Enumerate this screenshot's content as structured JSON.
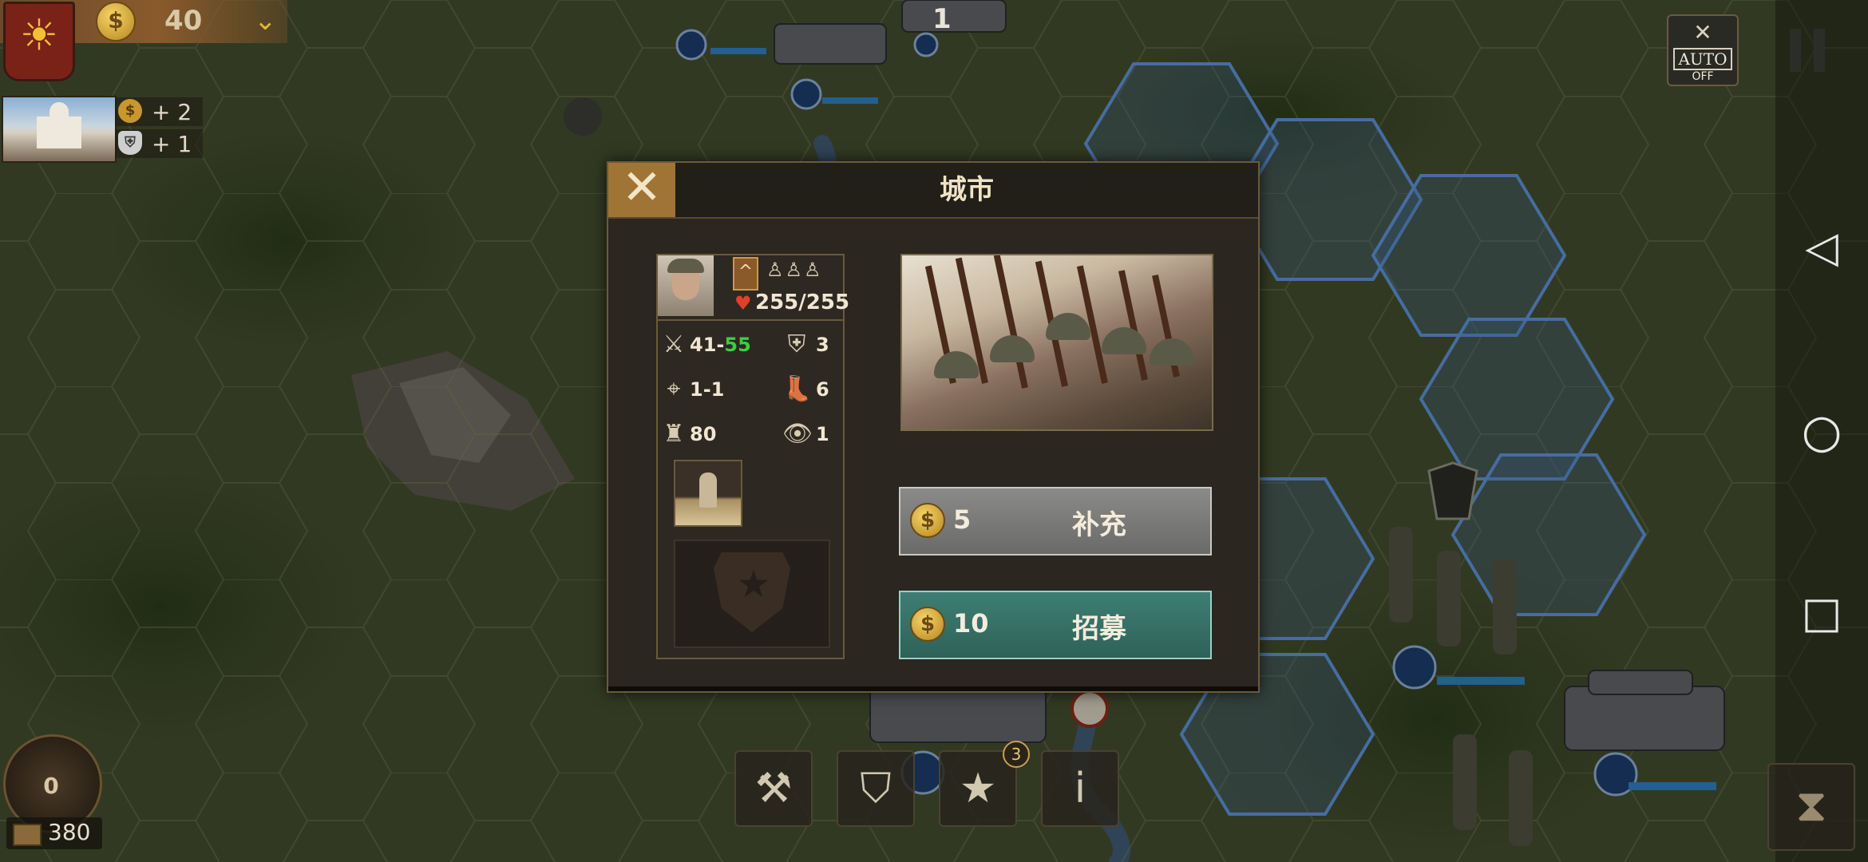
{
  "top_bar": {
    "faction_icon": "sun-emblem-icon",
    "gold": "40",
    "city_bonus_gold": "+ 2",
    "city_bonus_defense": "+ 1"
  },
  "top_right": {
    "auto_label": "AUTO",
    "auto_state": "OFF"
  },
  "bottom_left": {
    "turn_count": "0",
    "supply": "380"
  },
  "dialog": {
    "title": "城市",
    "unit": {
      "hp": "255/255",
      "attack_min": "41",
      "attack_max": "55",
      "defense": "3",
      "range": "1-1",
      "movement": "6",
      "organization": "80",
      "vision": "1"
    },
    "replenish": {
      "cost": "5",
      "label": "补充"
    },
    "recruit": {
      "cost": "10",
      "label": "招募"
    }
  },
  "map_labels": {
    "stack_count": "1",
    "badge_number": "3"
  },
  "colors": {
    "accent_gold": "#a07434",
    "recruit_teal": "#3e7e74",
    "replenish_gray": "#7a7a78",
    "attack_max_green": "#38d040",
    "hp_heart_red": "#e0402a"
  }
}
